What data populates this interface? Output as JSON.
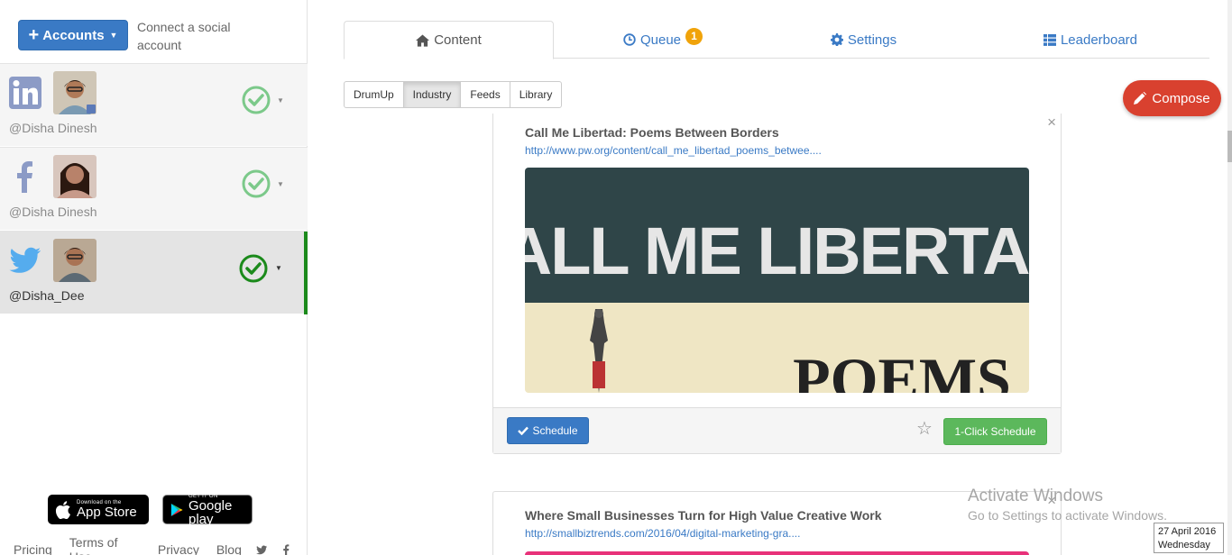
{
  "sidebar": {
    "accounts_label": "Accounts",
    "connect_text": "Connect a social account",
    "accounts": [
      {
        "network": "linkedin-icon",
        "handle": "@Disha Dinesh"
      },
      {
        "network": "facebook-icon",
        "handle": "@Disha Dinesh"
      },
      {
        "network": "twitter-icon",
        "handle": "@Disha_Dee"
      }
    ],
    "app_store": {
      "small": "Download on the",
      "big": "App Store"
    },
    "google_play": {
      "small": "GET IT ON",
      "big": "Google play"
    },
    "footer_links": [
      "Pricing",
      "Terms of Use",
      "Privacy",
      "Blog"
    ]
  },
  "tabs": {
    "content": "Content",
    "queue": "Queue",
    "queue_count": "1",
    "settings": "Settings",
    "leaderboard": "Leaderboard"
  },
  "subtabs": [
    "DrumUp",
    "Industry",
    "Feeds",
    "Library"
  ],
  "compose_label": "Compose",
  "cards": [
    {
      "title": "Call Me Libertad: Poems Between Borders",
      "url": "http://www.pw.org/content/call_me_libertad_poems_betwee....",
      "image_text_1": "CALL ME LIBERTAD:",
      "image_text_2": "POEMS"
    },
    {
      "title": "Where Small Businesses Turn for High Value Creative Work",
      "url": "http://smallbiztrends.com/2016/04/digital-marketing-gra...."
    }
  ],
  "card_actions": {
    "schedule": "Schedule",
    "one_click": "1-Click Schedule"
  },
  "windows": {
    "activate_title": "Activate Windows",
    "activate_sub": "Go to Settings to activate Windows.",
    "date": "27 April 2016",
    "day": "Wednesday"
  },
  "colors": {
    "primary": "#3a7ac5",
    "compose": "#d9412f",
    "success": "#5cb85c",
    "badge": "#f0a30a",
    "active_bar": "#1b8a1b"
  }
}
